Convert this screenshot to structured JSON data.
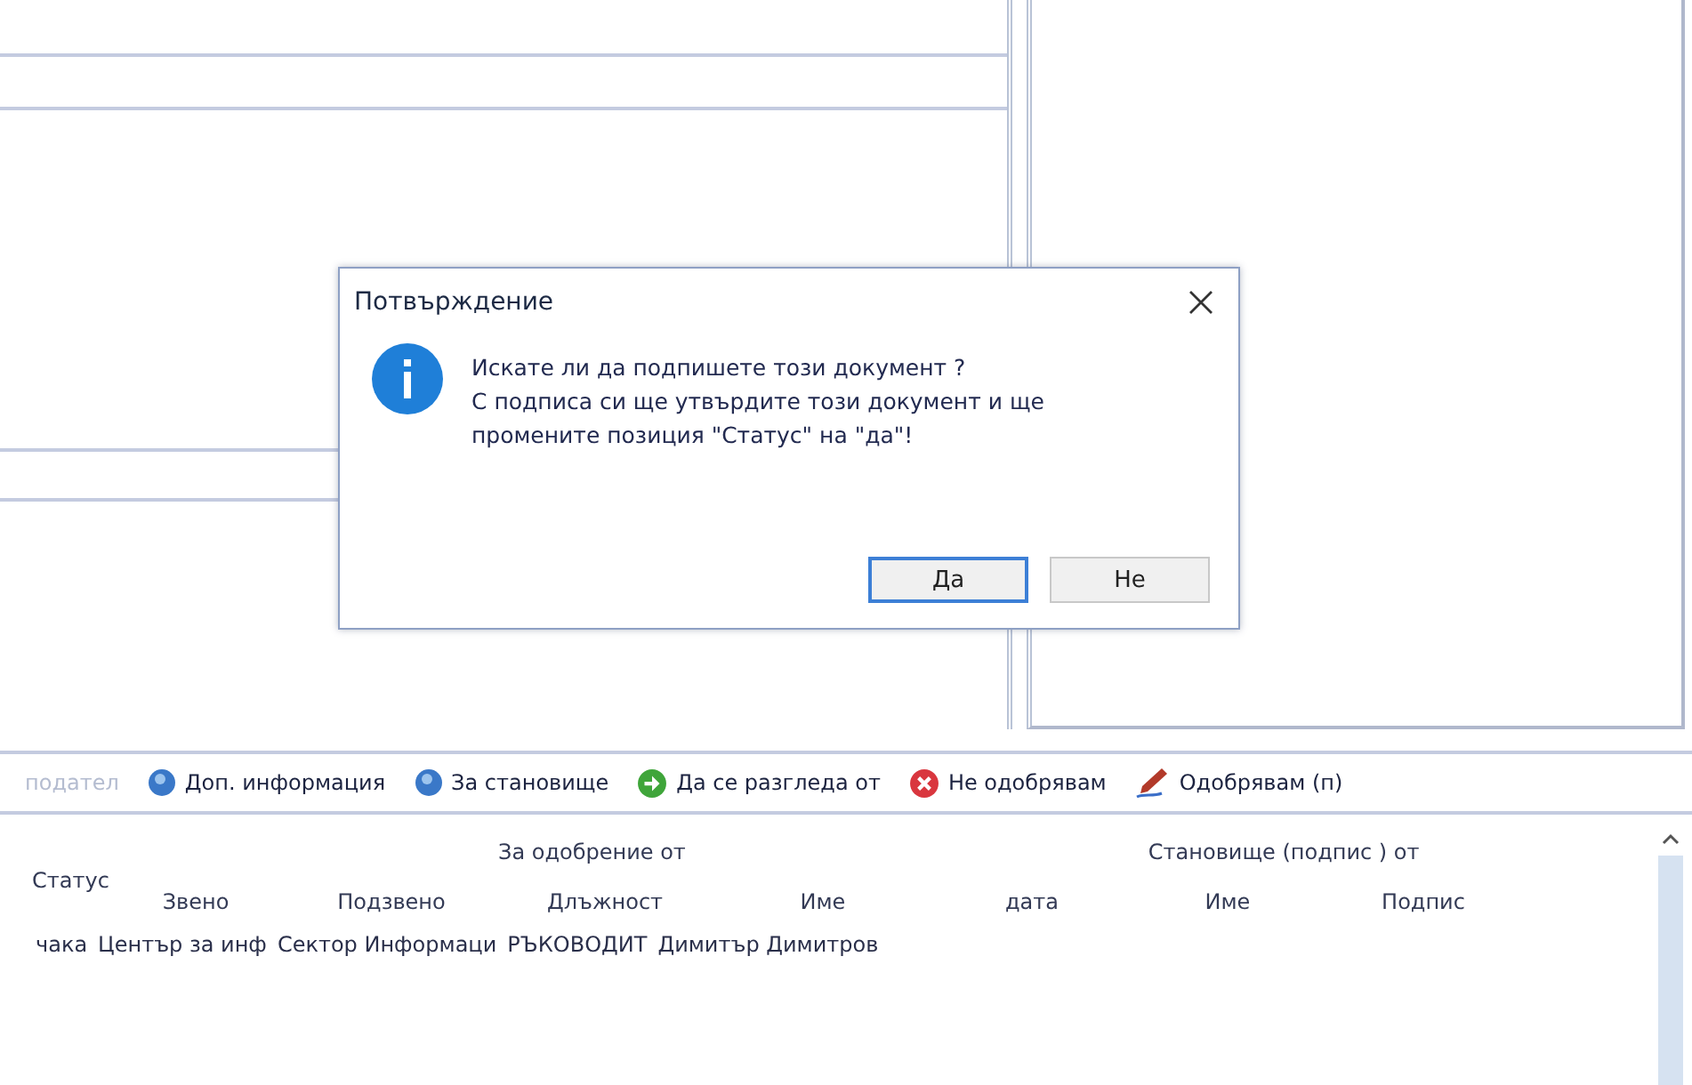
{
  "dialog": {
    "title": "Потвърждение",
    "lines": [
      "Искате ли да подпишете този документ ?",
      "С подписа си ще утвърдите този документ и ще",
      "промените позиция \"Статус\" на \"да\"!"
    ],
    "buttons": [
      {
        "label": "Да",
        "selected": true
      },
      {
        "label": "Не",
        "selected": false
      }
    ]
  },
  "toolbar": [
    {
      "label": "подател",
      "kind": "plain",
      "disabled": true
    },
    {
      "label": "Доп. информация",
      "kind": "help",
      "disabled": false
    },
    {
      "label": "За становище",
      "kind": "help",
      "disabled": false
    },
    {
      "label": "Да се разгледа от",
      "kind": "forward",
      "disabled": false
    },
    {
      "label": "Не одобрявам",
      "kind": "reject",
      "disabled": false
    },
    {
      "label": "Одобрявам (п)",
      "kind": "sign",
      "disabled": false
    }
  ],
  "table": {
    "groups": [
      "За одобрение от",
      "Становище (подпис ) от"
    ],
    "columns": [
      "Статус",
      "Звено",
      "Подзвено",
      "Длъжност",
      "Име",
      "дата",
      "Име",
      "Подпис"
    ],
    "rows": [
      [
        "чака",
        "Център за инф",
        "Сектор Информаци",
        "РЪКОВОДИТ",
        "Димитър Димитров"
      ]
    ]
  }
}
